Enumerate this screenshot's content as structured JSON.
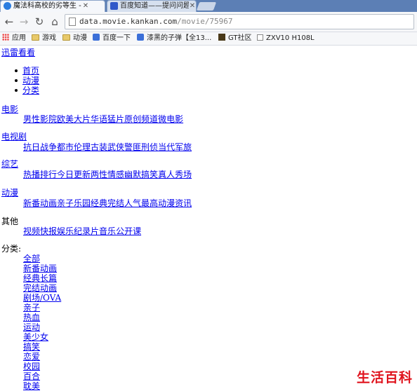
{
  "tabs": [
    {
      "title": "魔法科高校的劣等生 - 动",
      "icon_color": "#2b7de0"
    },
    {
      "title": "百度知道——提问问题",
      "icon_color": "#2f58c9"
    }
  ],
  "address": {
    "host": "data.movie.kankan.com",
    "path": "/movie/75967"
  },
  "bookmarks": [
    {
      "label": "应用",
      "icon": "apps-icon"
    },
    {
      "label": "游戏",
      "icon": "folder-icon"
    },
    {
      "label": "动漫",
      "icon": "folder-icon"
    },
    {
      "label": "百度一下",
      "icon": "paw-icon"
    },
    {
      "label": "漆黑的子弹【全13...",
      "icon": "site-icon"
    },
    {
      "label": "GT社区",
      "icon": "site-icon"
    },
    {
      "label": "ZXV10 H108L",
      "icon": "page-icon"
    }
  ],
  "site_title": "迅雷看看",
  "nav": [
    "首页",
    "动漫",
    "分类"
  ],
  "categories": [
    {
      "name": "电影",
      "items": [
        "男性影院",
        "欧美大片",
        "华语猛片",
        "原创频道",
        "微电影"
      ]
    },
    {
      "name": "电视剧",
      "items": [
        "抗日战争",
        "都市伦理",
        "古装武侠",
        "警匪刑侦",
        "当代军旅"
      ]
    },
    {
      "name": "综艺",
      "items": [
        "热播排行",
        "今日更新",
        "两性情感",
        "幽默搞笑",
        "真人秀场"
      ]
    },
    {
      "name": "动漫",
      "items": [
        "新番动画",
        "亲子乐园",
        "经典完结",
        "人气最高",
        "动漫资讯"
      ]
    },
    {
      "name": "其他",
      "items": [
        "视频快报",
        "娱乐",
        "纪录片",
        "音乐",
        "公开课"
      ]
    }
  ],
  "class_label": "分类:",
  "class_items": [
    "全部",
    "新番动画",
    "经典长篇",
    "完结动画",
    "剧场/OVA",
    "亲子",
    "热血",
    "运动",
    "美少女",
    "搞笑",
    "恋爱",
    "校园",
    "百合",
    "耽美"
  ],
  "watermark": "生活百科"
}
